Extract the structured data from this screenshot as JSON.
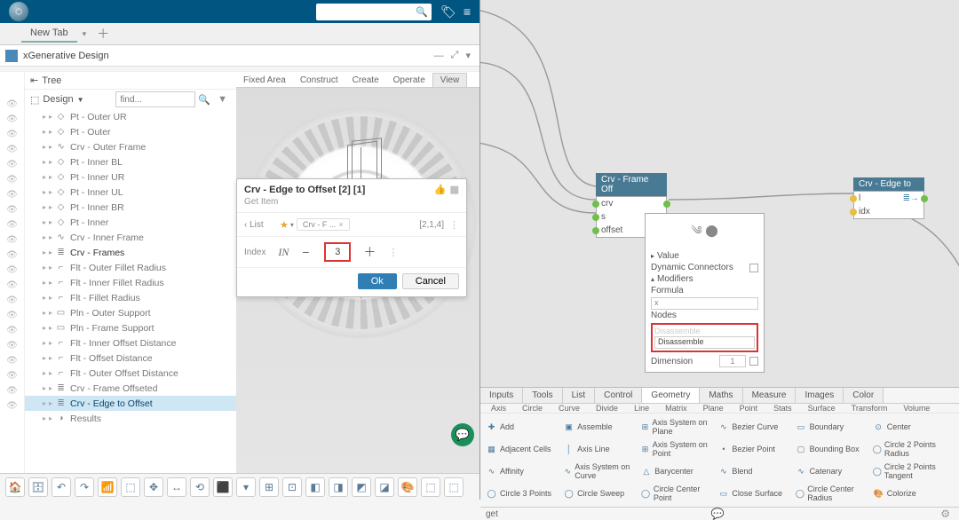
{
  "left": {
    "new_tab": "New Tab",
    "app_name": "xGenerative Design",
    "tree_label": "Tree",
    "design_label": "Design",
    "find_placeholder": "find...",
    "tree": [
      {
        "label": "Pt - Outer UR",
        "ico": "◇"
      },
      {
        "label": "Pt - Outer",
        "ico": "◇"
      },
      {
        "label": "Crv - Outer Frame",
        "ico": "∿"
      },
      {
        "label": "Pt - Inner BL",
        "ico": "◇"
      },
      {
        "label": "Pt - Inner UR",
        "ico": "◇"
      },
      {
        "label": "Pt - Inner UL",
        "ico": "◇"
      },
      {
        "label": "Pt - Inner BR",
        "ico": "◇"
      },
      {
        "label": "Pt - Inner",
        "ico": "◇"
      },
      {
        "label": "Crv - Inner Frame",
        "ico": "∿"
      },
      {
        "label": "Crv - Frames",
        "ico": "≣",
        "emph": true
      },
      {
        "label": "Flt - Outer Fillet Radius",
        "ico": "⌐"
      },
      {
        "label": "Flt - Inner Fillet Radius",
        "ico": "⌐"
      },
      {
        "label": "Flt - Fillet Radius",
        "ico": "⌐"
      },
      {
        "label": "Pln - Outer Support",
        "ico": "▭"
      },
      {
        "label": "Pln - Frame Support",
        "ico": "▭"
      },
      {
        "label": "Flt - Inner Offset Distance",
        "ico": "⌐"
      },
      {
        "label": "Flt - Offset Distance",
        "ico": "⌐"
      },
      {
        "label": "Flt - Outer Offset Distance",
        "ico": "⌐"
      },
      {
        "label": "Crv - Frame Offseted",
        "ico": "≣"
      },
      {
        "label": "Crv - Edge to Offset",
        "ico": "≣",
        "sel": true
      },
      {
        "label": "Results",
        "ico": "◑"
      }
    ],
    "view_tabs": [
      "Fixed Area",
      "Construct",
      "Create",
      "Operate",
      "View"
    ],
    "dialog": {
      "title": "Crv - Edge to Offset [2] [1]",
      "subtitle": "Get Item",
      "list_label": "‹ List",
      "chip": "Crv - F ...",
      "range": "[2,1,4]",
      "index_label": "Index",
      "int_tag": "IN",
      "value": "3",
      "ok": "Ok",
      "cancel": "Cancel"
    }
  },
  "right": {
    "node1": {
      "title": "Crv - Frame Off",
      "ports": [
        "crv",
        "s",
        "offset"
      ]
    },
    "node2": {
      "title": "Crv - Edge to",
      "ports": [
        "l",
        "idx"
      ]
    },
    "inspector": {
      "value": "Value",
      "dyn": "Dynamic Connectors",
      "mods": "Modifiers",
      "formula": "Formula",
      "formula_val": "x",
      "nodes": "Nodes",
      "disassemble_hint": "Disassemble",
      "disassemble": "Disassemble",
      "dimension": "Dimension",
      "dim_val": "1"
    },
    "cats": [
      "Inputs",
      "Tools",
      "List",
      "Control",
      "Geometry",
      "Maths",
      "Measure",
      "Images",
      "Color"
    ],
    "subcats": [
      "Axis",
      "Circle",
      "Curve",
      "Divide",
      "Line",
      "Matrix",
      "Plane",
      "Point",
      "Stats",
      "Surface",
      "Transform",
      "Volume"
    ],
    "ops": [
      "Add",
      "Assemble",
      "Axis System on Plane",
      "Bezier Curve",
      "Boundary",
      "Center",
      "Adjacent Cells",
      "Axis Line",
      "Axis System on Point",
      "Bezier Point",
      "Bounding Box",
      "Circle 2 Points Radius",
      "Affinity",
      "Axis System on Curve",
      "Barycenter",
      "Blend",
      "Catenary",
      "Circle 2 Points Tangent",
      "Circle 3 Points",
      "Circle Sweep",
      "Circle Center Point",
      "Close Surface",
      "Circle Center Radius",
      "Colorize"
    ],
    "search_val": "get"
  }
}
